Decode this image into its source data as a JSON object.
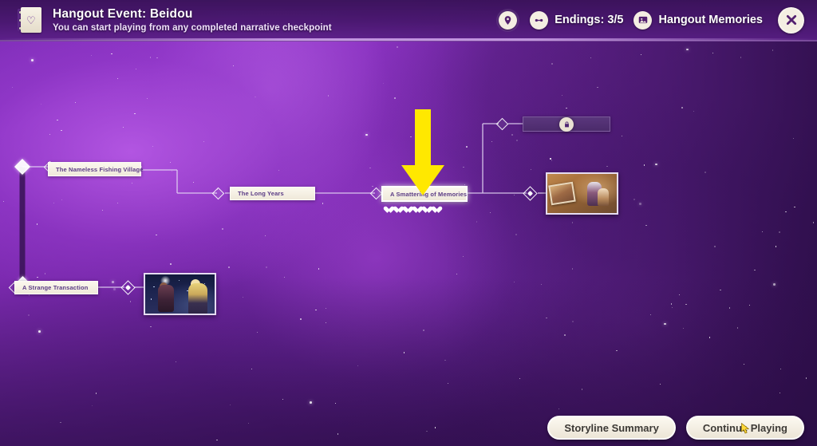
{
  "header": {
    "icon": "journal-heart-icon",
    "title": "Hangout Event: Beidou",
    "subtitle": "You can start playing from any completed narrative checkpoint",
    "pin_icon": "location-pin-icon",
    "endings_icon": "endings-icon",
    "endings_label": "Endings: 3/5",
    "memories_icon": "picture-icon",
    "memories_label": "Hangout Memories",
    "close_icon": "close-icon"
  },
  "graph": {
    "nodes": [
      {
        "id": "nameless-fishing-village",
        "label": "The Nameless Fishing Village",
        "state": "completed"
      },
      {
        "id": "the-long-years",
        "label": "The Long Years",
        "state": "completed"
      },
      {
        "id": "a-smattering-of-memories",
        "label": "A Smattering of Memories",
        "state": "selected",
        "hearts": 6
      },
      {
        "id": "a-strange-transaction",
        "label": "A Strange Transaction",
        "state": "completed"
      },
      {
        "id": "locked-ending",
        "label": "",
        "state": "locked",
        "icon": "lock-icon"
      }
    ],
    "thumbnails": [
      {
        "id": "memory-thumbnail-right",
        "alt": "sepia outdoor scene with photograph"
      },
      {
        "id": "memory-thumbnail-left",
        "alt": "night scene with two characters"
      }
    ],
    "annotation": {
      "arrow_icon": "down-arrow-annotation",
      "color": "#FFE800",
      "points_at": "a-smattering-of-memories"
    }
  },
  "footer": {
    "storyline_summary_label": "Storyline Summary",
    "continue_playing_label": "Continue Playing",
    "cursor_icon": "cursor-icon"
  },
  "colors": {
    "accent_yellow": "#FFE800",
    "panel_cream": "#F7F2E6",
    "node_text": "#5A3B85",
    "background_purple": "#7C2AB0"
  }
}
